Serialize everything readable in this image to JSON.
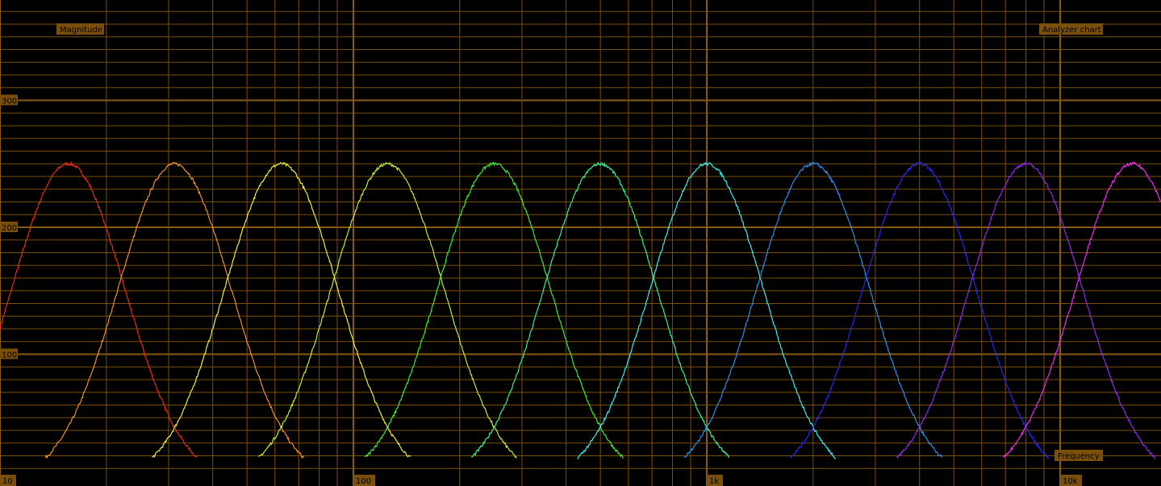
{
  "chart_data": {
    "type": "line",
    "title": "Analyzer chart",
    "xlabel": "Frequency",
    "ylabel": "Magnitude",
    "x_scale": "log",
    "xlim": [
      10,
      16000
    ],
    "ylim": [
      0,
      380
    ],
    "x_ticks": [
      {
        "value": 10,
        "label": "10"
      },
      {
        "value": 100,
        "label": "100"
      },
      {
        "value": 1000,
        "label": "1k"
      },
      {
        "value": 10000,
        "label": "10k"
      }
    ],
    "y_ticks": [
      {
        "value": 100,
        "label": "100"
      },
      {
        "value": 200,
        "label": "200"
      },
      {
        "value": 300,
        "label": "300"
      }
    ],
    "grid": true,
    "series": [
      {
        "center": 15.6,
        "peak": 250,
        "color": "#ff2a1a"
      },
      {
        "center": 31.2,
        "peak": 250,
        "color": "#ff9a2e"
      },
      {
        "center": 62.5,
        "peak": 250,
        "color": "#ffff3a"
      },
      {
        "center": 125,
        "peak": 250,
        "color": "#c8ff3a"
      },
      {
        "center": 250,
        "peak": 250,
        "color": "#3aff3a"
      },
      {
        "center": 500,
        "peak": 250,
        "color": "#3aff9a"
      },
      {
        "center": 1000,
        "peak": 250,
        "color": "#3affff"
      },
      {
        "center": 2000,
        "peak": 250,
        "color": "#2a9aff"
      },
      {
        "center": 4000,
        "peak": 250,
        "color": "#2a2aff"
      },
      {
        "center": 8000,
        "peak": 250,
        "color": "#9a2aff"
      },
      {
        "center": 16000,
        "peak": 250,
        "color": "#ff2aff"
      }
    ]
  }
}
